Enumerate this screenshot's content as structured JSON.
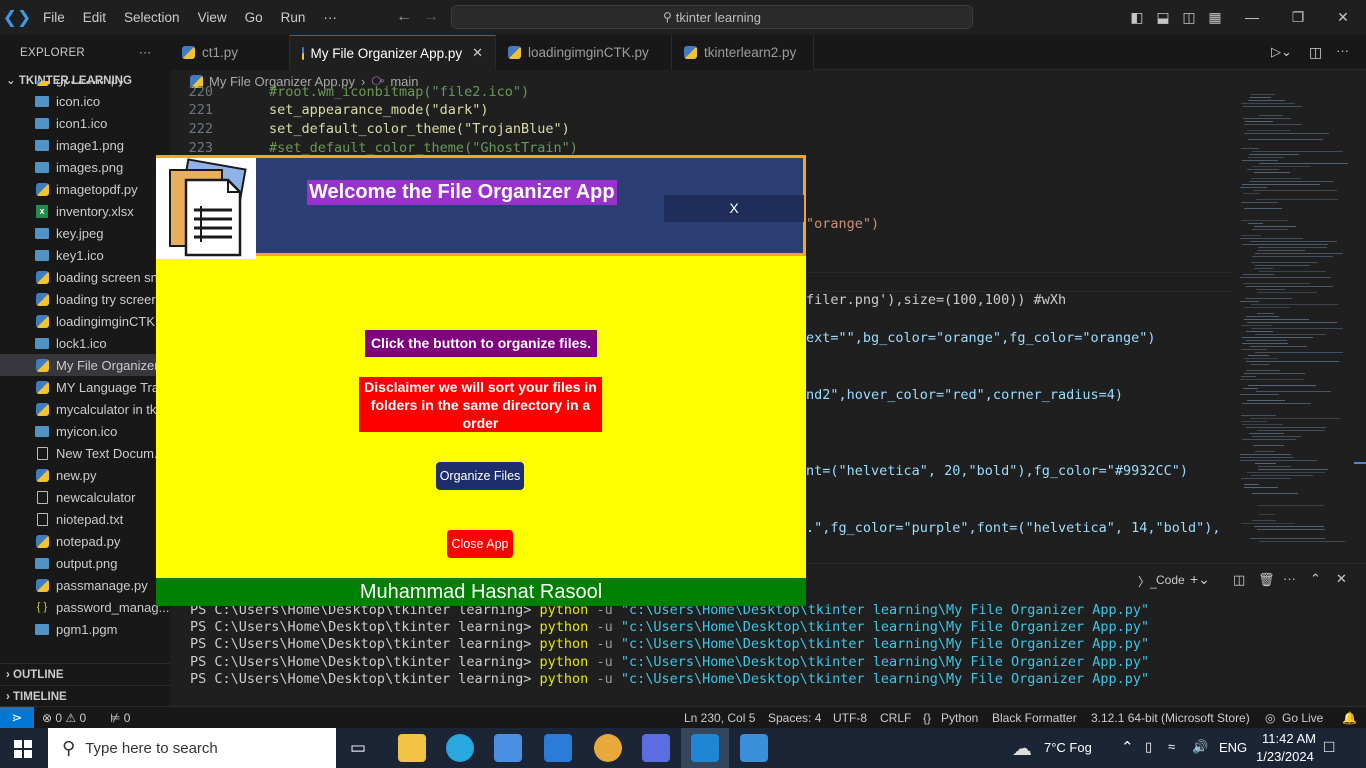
{
  "titlebar": {
    "menus": [
      "File",
      "Edit",
      "Selection",
      "View",
      "Go",
      "Run",
      "···"
    ],
    "search_text": "tkinter learning"
  },
  "sidebar": {
    "explorer_label": "EXPLORER",
    "folder_label": "TKINTER LEARNING",
    "files": [
      {
        "name": "gpt form .py",
        "icon": "python-icon"
      },
      {
        "name": "icon.ico",
        "icon": "image-icon"
      },
      {
        "name": "icon1.ico",
        "icon": "image-icon"
      },
      {
        "name": "image1.png",
        "icon": "image-icon"
      },
      {
        "name": "images.png",
        "icon": "image-icon"
      },
      {
        "name": "imagetopdf.py",
        "icon": "python-icon"
      },
      {
        "name": "inventory.xlsx",
        "icon": "excel-icon"
      },
      {
        "name": "key.jpeg",
        "icon": "image-icon"
      },
      {
        "name": "key1.ico",
        "icon": "image-icon"
      },
      {
        "name": "loading screen sn",
        "icon": "python-icon"
      },
      {
        "name": "loading try screer",
        "icon": "python-icon"
      },
      {
        "name": "loadingimginCTK.",
        "icon": "python-icon"
      },
      {
        "name": "lock1.ico",
        "icon": "image-icon"
      },
      {
        "name": "My File Organizer",
        "icon": "python-icon"
      },
      {
        "name": "MY Language Tra",
        "icon": "python-icon"
      },
      {
        "name": "mycalculator in tk",
        "icon": "python-icon"
      },
      {
        "name": "myicon.ico",
        "icon": "image-icon"
      },
      {
        "name": "New Text Docum...",
        "icon": "text-icon"
      },
      {
        "name": "new.py",
        "icon": "python-icon"
      },
      {
        "name": "newcalculator",
        "icon": "text-icon"
      },
      {
        "name": "niotepad.txt",
        "icon": "text-icon"
      },
      {
        "name": "notepad.py",
        "icon": "python-icon"
      },
      {
        "name": "output.png",
        "icon": "image-icon"
      },
      {
        "name": "passmanage.py",
        "icon": "python-icon"
      },
      {
        "name": "password_manag...",
        "icon": "json-icon"
      },
      {
        "name": "pgm1.pgm",
        "icon": "image-icon"
      }
    ],
    "outline_label": "OUTLINE",
    "timeline_label": "TIMELINE"
  },
  "tabs": [
    {
      "label": "ct1.py"
    },
    {
      "label": "My File Organizer App.py"
    },
    {
      "label": "loadingimginCTK.py"
    },
    {
      "label": "tkinterlearn2.py"
    }
  ],
  "breadcrumb": {
    "file": "My File Organizer App.py",
    "symbol": "main"
  },
  "editor": {
    "line_numbers": [
      "220",
      "221",
      "222",
      "223"
    ],
    "lines": [
      "#root.wm_iconbitmap(\"file2.ico\")",
      "set_appearance_mode(\"dark\")",
      "set_default_color_theme(\"TrojanBlue\")",
      "#set_default_color_theme(\"GhostTrain\")"
    ],
    "fragments": [
      "\"orange\")",
      "filer.png'),size=(100,100)) #wXh",
      "ext=\"\",bg_color=\"orange\",fg_color=\"orange\")",
      "nd2\",hover_color=\"red\",corner_radius=4)",
      "nt=(\"helvetica\", 20,\"bold\"),fg_color=\"#9932CC\")",
      ".\",fg_color=\"purple\",font=(\"helvetica\", 14,\"bold\"),"
    ]
  },
  "panel": {
    "terminal_label": "Code",
    "prompt": "PS C:\\Users\\Home\\Desktop\\tkinter learning>",
    "command": "python",
    "flag": "-u",
    "path": "\"c:\\Users\\Home\\Desktop\\tkinter learning\\My File Organizer App.py\""
  },
  "statusbar": {
    "problems": "⊗ 0 ⚠ 0",
    "ports": "0",
    "position": "Ln 230, Col 5",
    "spaces": "Spaces: 4",
    "encoding": "UTF-8",
    "eol": "CRLF",
    "language": "Python",
    "formatter": "Black Formatter",
    "interpreter": "3.12.1 64-bit (Microsoft Store)",
    "golive": "Go Live"
  },
  "app": {
    "welcome": "Welcome the File Organizer App",
    "x_button": "X",
    "instruction": "Click the button to organize files.",
    "disclaimer": "Disclaimer we will sort your files in folders in the same directory in a order",
    "organize_button": "Organize Files",
    "close_button": "Close App",
    "footer": "Muhammad Hasnat Rasool"
  },
  "taskbar": {
    "search_placeholder": "Type here to search",
    "weather": "7°C  Fog",
    "language": "ENG",
    "time": "11:42 AM",
    "date": "1/23/2024"
  }
}
